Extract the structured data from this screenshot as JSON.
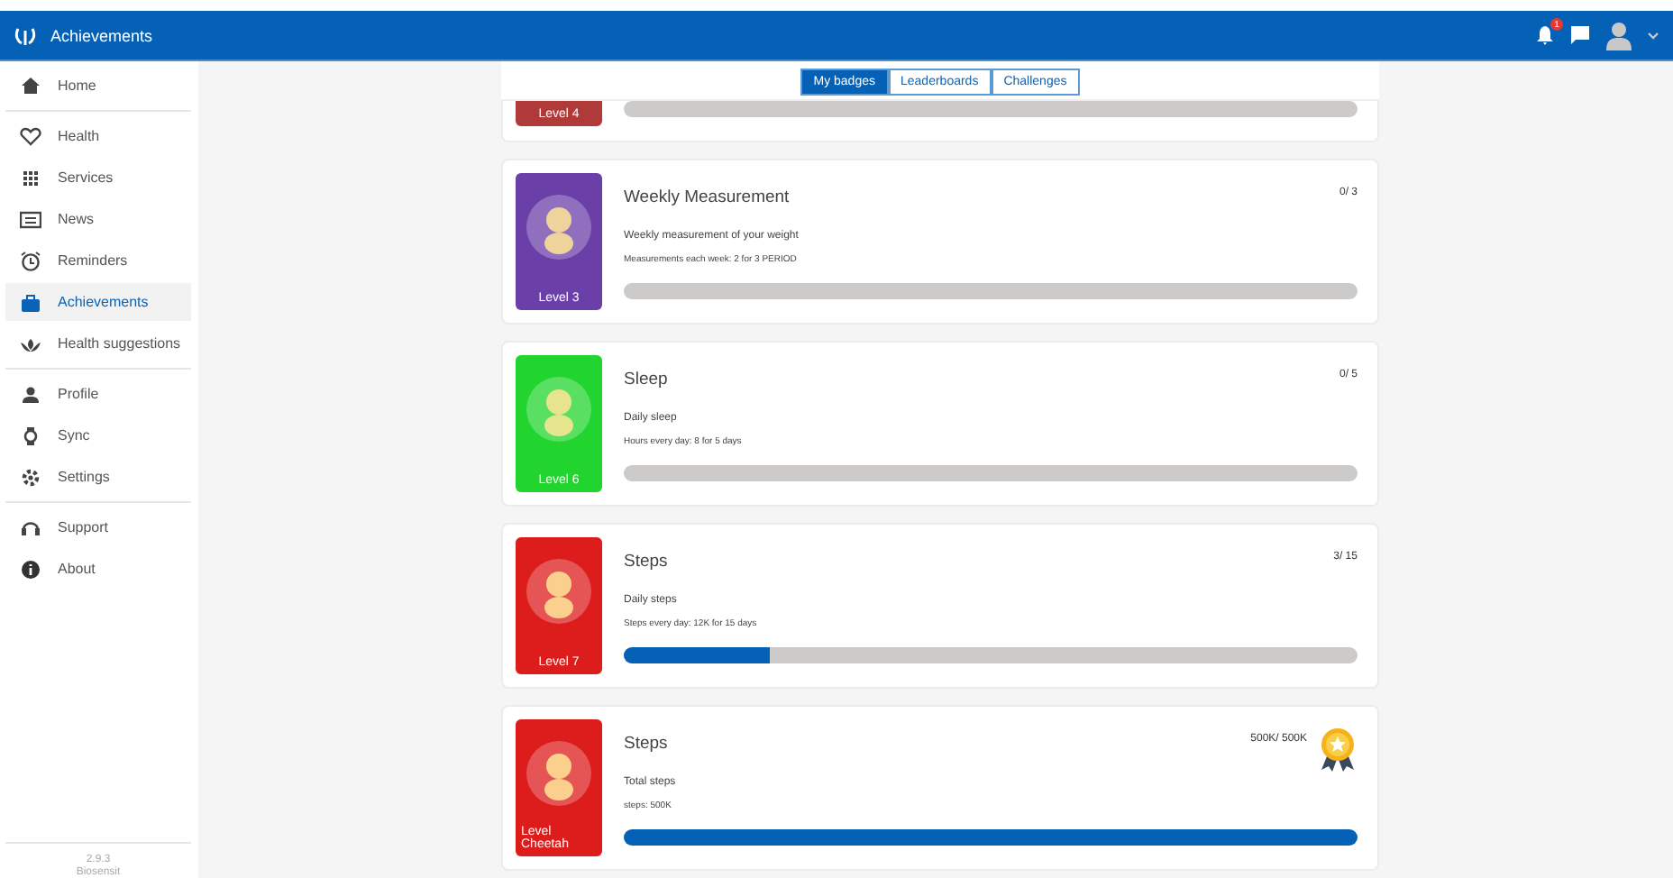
{
  "header": {
    "title": "Achievements",
    "notification_count": "1"
  },
  "sidebar": {
    "groups": [
      {
        "items": [
          {
            "label": "Home",
            "selected": false
          }
        ]
      },
      {
        "items": [
          {
            "label": "Health",
            "selected": false
          },
          {
            "label": "Services",
            "selected": false
          },
          {
            "label": "News",
            "selected": false
          },
          {
            "label": "Reminders",
            "selected": false
          },
          {
            "label": "Achievements",
            "selected": true
          },
          {
            "label": "Health suggestions",
            "selected": false
          }
        ]
      },
      {
        "items": [
          {
            "label": "Profile",
            "selected": false
          },
          {
            "label": "Sync",
            "selected": false
          },
          {
            "label": "Settings",
            "selected": false
          }
        ]
      },
      {
        "items": [
          {
            "label": "Support",
            "selected": false
          },
          {
            "label": "About",
            "selected": false
          }
        ]
      }
    ],
    "version": "2.9.3",
    "footer": "Biosensit"
  },
  "tabs": [
    {
      "label": "My badges",
      "selected": true
    },
    {
      "label": "Leaderboards",
      "selected": false
    },
    {
      "label": "Challenges",
      "selected": false
    }
  ],
  "badges": [
    {
      "kind": "cut",
      "level_label": "Level 4",
      "color": "#b03a3a",
      "level": 0
    },
    {
      "kind": "full",
      "level_label": "Level 3",
      "color": "#6a3fa8",
      "title": "Weekly Measurement",
      "count": "0/ 3",
      "description": "Weekly measurement of your weight",
      "goal": "Measurements each week: 2 for 3 PERIOD",
      "level": 0,
      "medal": false
    },
    {
      "kind": "full",
      "level_label": "Level 6",
      "color": "#22d42e",
      "title": "Sleep",
      "count": "0/ 5",
      "description": "Daily sleep",
      "goal": "Hours every day: 8 for 5 days",
      "level": 0,
      "medal": false
    },
    {
      "kind": "full",
      "level_label": "Level 7",
      "color": "#dd1c1c",
      "title": "Steps",
      "count": "3/ 15",
      "description": "Daily steps",
      "goal": "Steps every day: 12K for 15 days",
      "level": 0.2,
      "medal": false
    },
    {
      "kind": "full",
      "level_label": "Level Cheetah",
      "color": "#dd1c1c",
      "title": "Steps",
      "count": "500K/ 500K",
      "description": "Total steps",
      "goal": "steps: 500K",
      "level": 1,
      "medal": true
    }
  ]
}
